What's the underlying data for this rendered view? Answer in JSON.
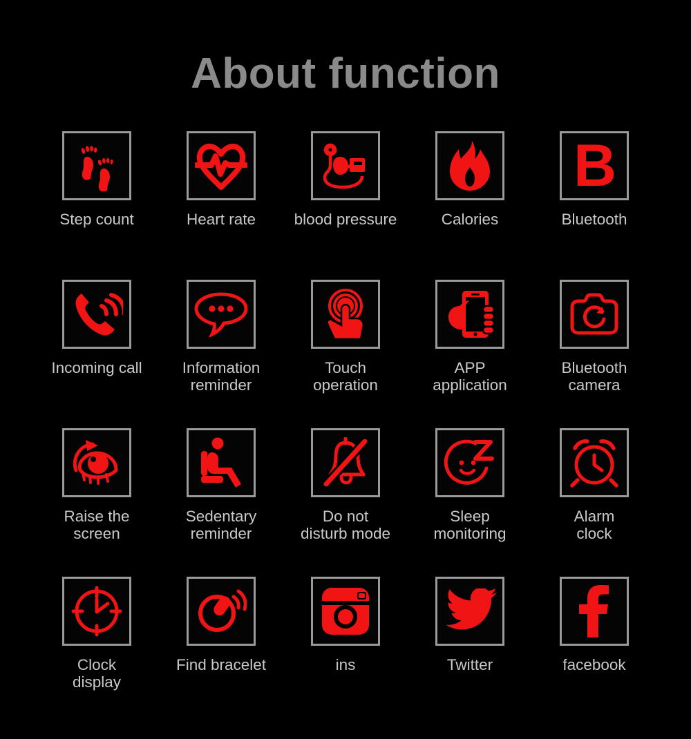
{
  "page": {
    "title": "About function",
    "background_color": "#000000",
    "title_color": "#8a8a8a",
    "label_color": "#c9c9c9",
    "icon_color": "#F01414",
    "icon_border_color": "#9a9a9a"
  },
  "features": [
    {
      "label": "Step count",
      "icon": "footprints-icon"
    },
    {
      "label": "Heart rate",
      "icon": "heart-rate-icon"
    },
    {
      "label": "blood pressure",
      "icon": "blood-pressure-icon"
    },
    {
      "label": "Calories",
      "icon": "flame-icon"
    },
    {
      "label": "Bluetooth",
      "icon": "letter-b-icon"
    },
    {
      "label": "Incoming call",
      "icon": "ringing-phone-icon"
    },
    {
      "label": "Information\nreminder",
      "icon": "speech-bubble-icon"
    },
    {
      "label": "Touch\noperation",
      "icon": "touch-hand-icon"
    },
    {
      "label": "APP\napplication",
      "icon": "hand-holding-phone-icon"
    },
    {
      "label": "Bluetooth\ncamera",
      "icon": "camera-icon"
    },
    {
      "label": "Raise the\nscreen",
      "icon": "eye-raise-icon"
    },
    {
      "label": "Sedentary\nreminder",
      "icon": "seated-person-icon"
    },
    {
      "label": "Do not\ndisturb mode",
      "icon": "bell-muted-icon"
    },
    {
      "label": "Sleep\nmonitoring",
      "icon": "sleeping-face-icon"
    },
    {
      "label": "Alarm\nclock",
      "icon": "alarm-clock-icon"
    },
    {
      "label": "Clock\ndisplay",
      "icon": "clock-face-icon"
    },
    {
      "label": "Find bracelet",
      "icon": "vibrating-bracelet-icon"
    },
    {
      "label": "ins",
      "icon": "instagram-icon"
    },
    {
      "label": "Twitter",
      "icon": "twitter-bird-icon"
    },
    {
      "label": "facebook",
      "icon": "facebook-f-icon"
    }
  ],
  "glyphs": {
    "bluetooth_letter": "B",
    "facebook_letter": "f"
  }
}
